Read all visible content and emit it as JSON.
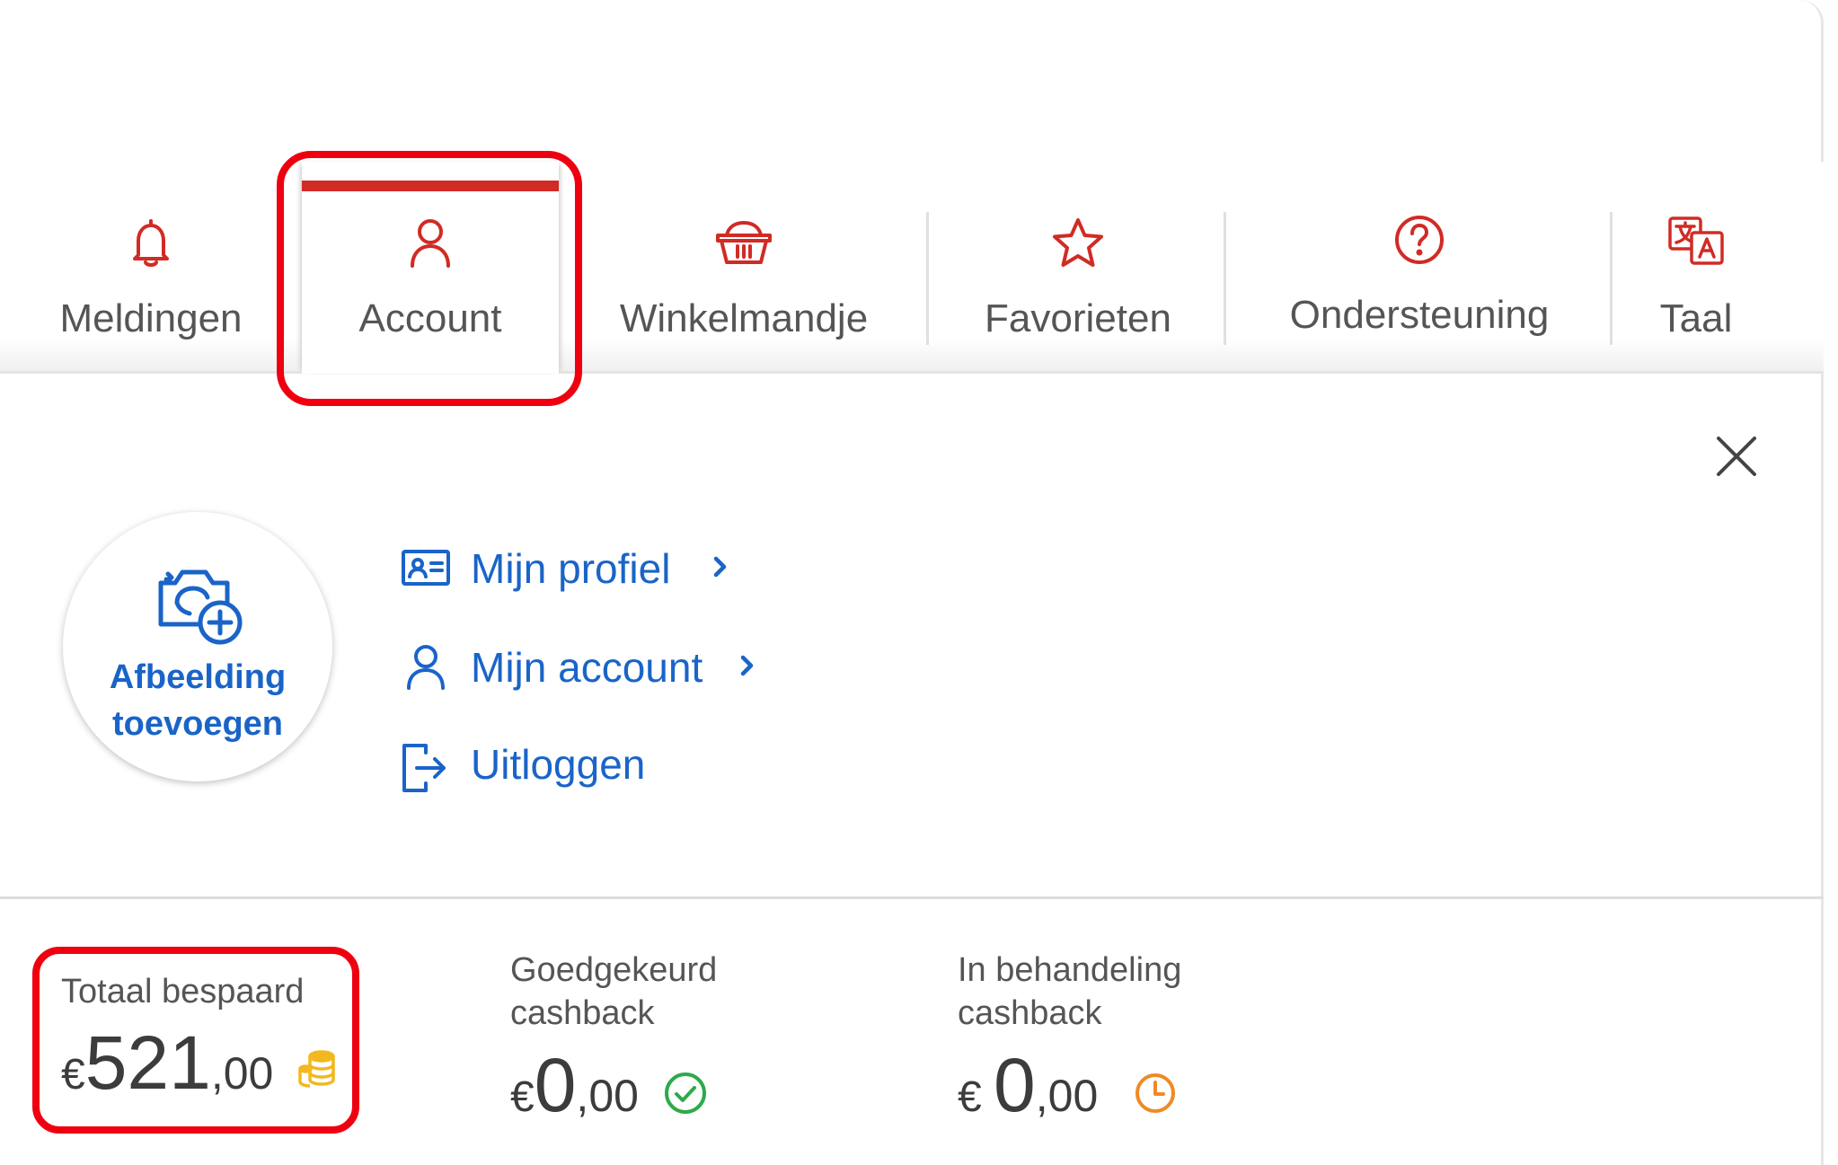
{
  "tabs": [
    {
      "label": "Meldingen",
      "icon": "bell-icon"
    },
    {
      "label": "Account",
      "icon": "person-icon",
      "active": true
    },
    {
      "label": "Winkelmandje",
      "icon": "basket-icon"
    },
    {
      "label": "Favorieten",
      "icon": "star-icon"
    },
    {
      "label": "Ondersteuning",
      "icon": "question-circle-icon"
    },
    {
      "label": "Taal",
      "icon": "translate-icon"
    }
  ],
  "account_panel": {
    "avatar": {
      "line1": "Afbeelding",
      "line2": "toevoegen",
      "icon": "camera-plus-icon"
    },
    "links": [
      {
        "label": "Mijn profiel",
        "icon": "id-card-icon",
        "chevron": true
      },
      {
        "label": "Mijn account",
        "icon": "person-icon",
        "chevron": true
      },
      {
        "label": "Uitloggen",
        "icon": "logout-icon",
        "chevron": false
      }
    ],
    "close_icon": "close-icon"
  },
  "stats": {
    "total": {
      "label": "Totaal bespaard",
      "currency": "€",
      "integer": "521",
      "decimal": ",00",
      "icon": "coins-icon"
    },
    "approved": {
      "label_line1": "Goedgekeurd",
      "label_line2": "cashback",
      "currency": "€",
      "integer": "0",
      "decimal": ",00",
      "icon": "check-circle-icon"
    },
    "pending": {
      "label_line1": "In behandeling",
      "label_line2": "cashback",
      "currency": "€ ",
      "integer": "0",
      "decimal": ",00",
      "icon": "clock-icon"
    }
  },
  "colors": {
    "accent_red": "#d12b25",
    "link_blue": "#1a64c8",
    "check_green": "#2eaa4a",
    "clock_orange": "#f08a24",
    "coins_yellow": "#f3b81f",
    "highlight_red": "#ee0010"
  }
}
